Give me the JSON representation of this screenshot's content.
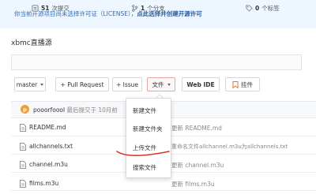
{
  "notice": {
    "text": "你当前开源项目尚未选择许可证（LICENSE），",
    "link": "点此选择并创建开源许可"
  },
  "repo": {
    "name": "xbmc直播源"
  },
  "stats": {
    "commits": {
      "count": "51",
      "label": "次提交"
    },
    "branches": {
      "count": "1",
      "label": "个分支"
    },
    "tags": {
      "count": "0",
      "label": "个标签"
    }
  },
  "toolbar": {
    "branch": "master",
    "pull_request": "+ Pull Request",
    "issue": "+ Issue",
    "file_menu": "文件",
    "web_ide": "Web IDE",
    "pin": "挂件"
  },
  "commit": {
    "avatar_letter": "p",
    "user": "pooorfoool",
    "meta": "最后提交于 10月前"
  },
  "files": [
    {
      "name": "README.md",
      "message": "更新 README.md"
    },
    {
      "name": "allchannels.txt",
      "message": "重命名文件allchannel.m3u为allchannels.txt"
    },
    {
      "name": "channel.m3u",
      "message": "更新 channel.m3u"
    },
    {
      "name": "films.m3u",
      "message": "更新 films.m3u"
    }
  ],
  "menu": {
    "items": [
      "新建文件",
      "新建文件夹",
      "上传文件",
      "搜索文件"
    ]
  },
  "colors": {
    "accent_red": "#d9342b",
    "link_blue": "#3a6fb0"
  }
}
